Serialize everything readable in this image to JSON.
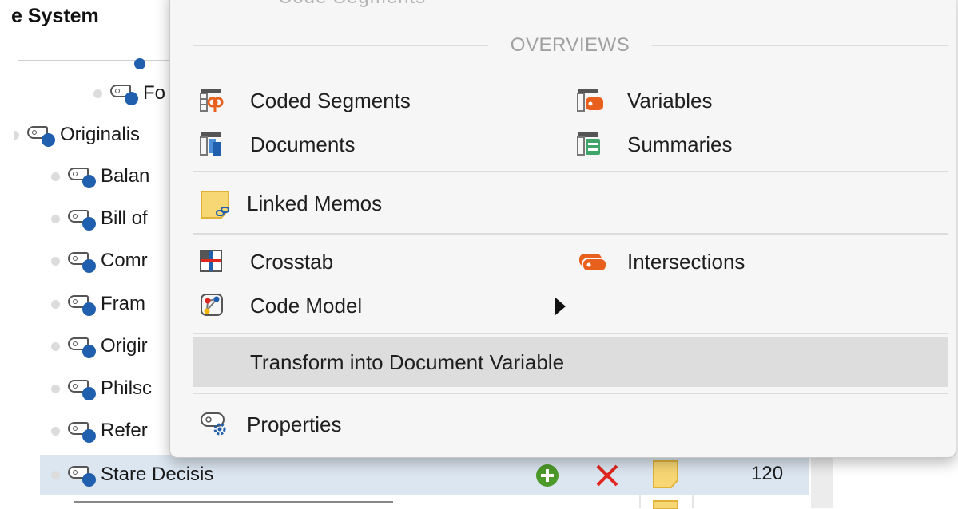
{
  "code_system": {
    "title_fragment": "e System",
    "rows": [
      {
        "label": "Fo"
      },
      {
        "label": "Originalis"
      },
      {
        "label": "Balan"
      },
      {
        "label": "Bill of"
      },
      {
        "label": "Comr"
      },
      {
        "label": "Fram"
      },
      {
        "label": "Origir"
      },
      {
        "label": "Philsc"
      },
      {
        "label": "Refer"
      }
    ],
    "selected": {
      "label": "Stare Decisis",
      "count": "120"
    }
  },
  "menu": {
    "faded_top_text": "Code Segments",
    "section_overviews": "OVERVIEWS",
    "items": {
      "coded_segments": "Coded Segments",
      "variables": "Variables",
      "documents": "Documents",
      "summaries": "Summaries",
      "linked_memos": "Linked Memos",
      "crosstab": "Crosstab",
      "intersections": "Intersections",
      "code_model": "Code Model",
      "transform": "Transform into Document Variable",
      "properties": "Properties"
    }
  },
  "colors": {
    "accent_orange": "#e8601c",
    "code_blue": "#1f5fae",
    "memo_yellow": "#f7d774",
    "add_green": "#4c9a2a",
    "delete_red": "#e0271f"
  },
  "icons": {
    "add": "plus-circle-icon",
    "delete": "x-icon"
  }
}
